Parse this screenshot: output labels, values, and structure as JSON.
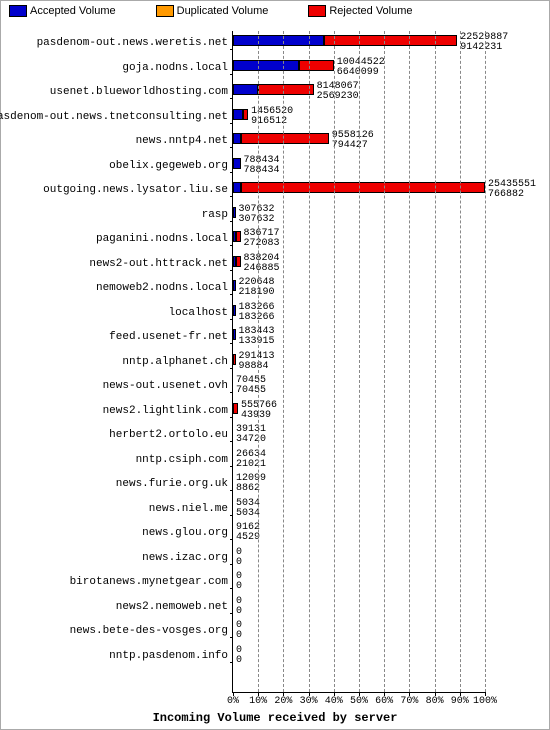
{
  "legend": {
    "accepted": "Accepted Volume",
    "duplicated": "Duplicated Volume",
    "rejected": "Rejected Volume"
  },
  "colors": {
    "accepted": "#0000cc",
    "duplicated": "#ff9900",
    "rejected": "#ee0000"
  },
  "x_title": "Incoming Volume received by server",
  "x_ticks": [
    "0%",
    "10%",
    "20%",
    "30%",
    "40%",
    "50%",
    "60%",
    "70%",
    "80%",
    "90%",
    "100%"
  ],
  "chart_data": {
    "type": "bar",
    "title": "Incoming Volume received by server",
    "xlabel": "Incoming Volume received by server",
    "ylabel": "",
    "xlim": [
      0,
      100
    ],
    "series_names": [
      "Accepted Volume",
      "Duplicated Volume",
      "Rejected Volume"
    ],
    "rows": [
      {
        "label": "pasdenom-out.news.weretis.net",
        "stack": [
          36,
          0,
          53
        ],
        "v1": "22529887",
        "v2": "9142231"
      },
      {
        "label": "goja.nodns.local",
        "stack": [
          26,
          0,
          14
        ],
        "v1": "10044522",
        "v2": "6640099"
      },
      {
        "label": "usenet.blueworldhosting.com",
        "stack": [
          10,
          0,
          22
        ],
        "v1": "8148067",
        "v2": "2569230"
      },
      {
        "label": "pasdenom-out.news.tnetconsulting.net",
        "stack": [
          4,
          0,
          2
        ],
        "v1": "1456520",
        "v2": "916512"
      },
      {
        "label": "news.nntp4.net",
        "stack": [
          3,
          0,
          35
        ],
        "v1": "9558126",
        "v2": "794427"
      },
      {
        "label": "obelix.gegeweb.org",
        "stack": [
          3,
          0,
          0
        ],
        "v1": "788434",
        "v2": "788434"
      },
      {
        "label": "outgoing.news.lysator.liu.se",
        "stack": [
          3,
          0,
          97
        ],
        "v1": "25435551",
        "v2": "766882"
      },
      {
        "label": "rasp",
        "stack": [
          1,
          0,
          0
        ],
        "v1": "307632",
        "v2": "307632"
      },
      {
        "label": "paganini.nodns.local",
        "stack": [
          1,
          0,
          2
        ],
        "v1": "836717",
        "v2": "272083"
      },
      {
        "label": "news2-out.httrack.net",
        "stack": [
          1,
          0,
          2
        ],
        "v1": "838204",
        "v2": "246885"
      },
      {
        "label": "nemoweb2.nodns.local",
        "stack": [
          1,
          0,
          0
        ],
        "v1": "220648",
        "v2": "218190"
      },
      {
        "label": "localhost",
        "stack": [
          1,
          0,
          0
        ],
        "v1": "183266",
        "v2": "183266"
      },
      {
        "label": "feed.usenet-fr.net",
        "stack": [
          1,
          0,
          0
        ],
        "v1": "183443",
        "v2": "133915"
      },
      {
        "label": "nntp.alphanet.ch",
        "stack": [
          0,
          0,
          1
        ],
        "v1": "291413",
        "v2": "98884"
      },
      {
        "label": "news-out.usenet.ovh",
        "stack": [
          0,
          0,
          0
        ],
        "v1": "70455",
        "v2": "70455"
      },
      {
        "label": "news2.lightlink.com",
        "stack": [
          0,
          0,
          2
        ],
        "v1": "555766",
        "v2": "43939"
      },
      {
        "label": "herbert2.ortolo.eu",
        "stack": [
          0,
          0,
          0
        ],
        "v1": "39131",
        "v2": "34720"
      },
      {
        "label": "nntp.csiph.com",
        "stack": [
          0,
          0,
          0
        ],
        "v1": "26634",
        "v2": "21021"
      },
      {
        "label": "news.furie.org.uk",
        "stack": [
          0,
          0,
          0
        ],
        "v1": "12099",
        "v2": "8862"
      },
      {
        "label": "news.niel.me",
        "stack": [
          0,
          0,
          0
        ],
        "v1": "5034",
        "v2": "5034"
      },
      {
        "label": "news.glou.org",
        "stack": [
          0,
          0,
          0
        ],
        "v1": "9162",
        "v2": "4529"
      },
      {
        "label": "news.izac.org",
        "stack": [
          0,
          0,
          0
        ],
        "v1": "0",
        "v2": "0"
      },
      {
        "label": "birotanews.mynetgear.com",
        "stack": [
          0,
          0,
          0
        ],
        "v1": "0",
        "v2": "0"
      },
      {
        "label": "news2.nemoweb.net",
        "stack": [
          0,
          0,
          0
        ],
        "v1": "0",
        "v2": "0"
      },
      {
        "label": "news.bete-des-vosges.org",
        "stack": [
          0,
          0,
          0
        ],
        "v1": "0",
        "v2": "0"
      },
      {
        "label": "nntp.pasdenom.info",
        "stack": [
          0,
          0,
          0
        ],
        "v1": "0",
        "v2": "0"
      }
    ]
  }
}
